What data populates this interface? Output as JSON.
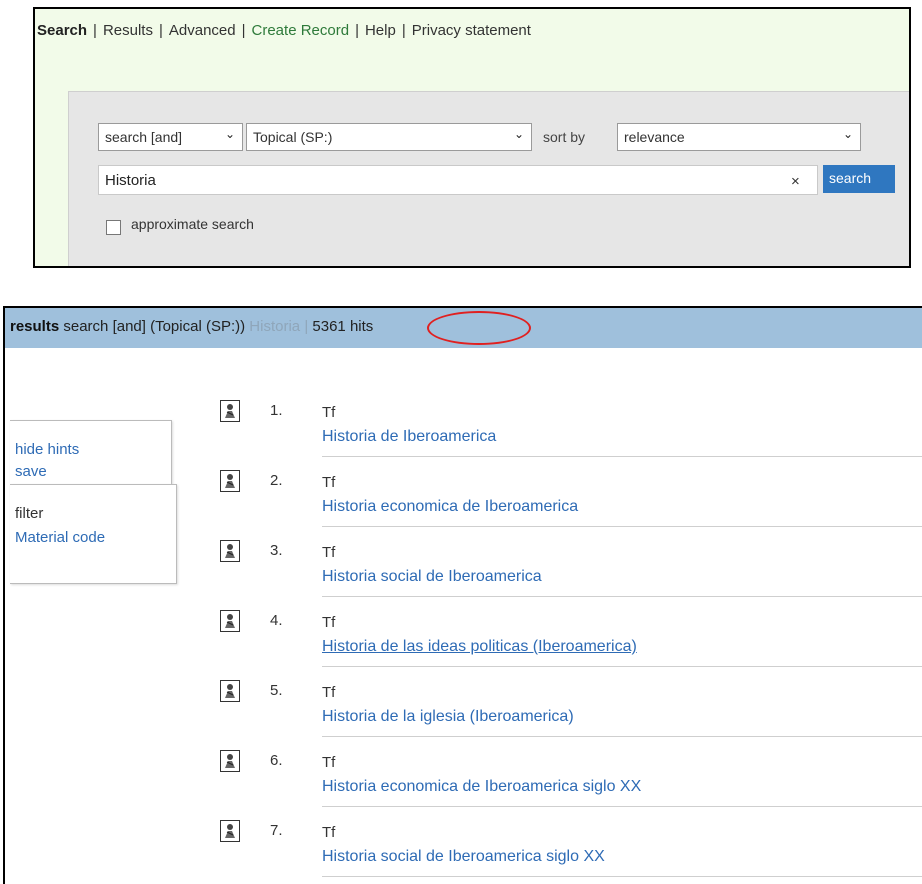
{
  "top_nav": {
    "items": [
      {
        "label": "Search",
        "current": true
      },
      {
        "label": "Results"
      },
      {
        "label": "Advanced"
      },
      {
        "label": "Create Record"
      },
      {
        "label": "Help"
      },
      {
        "label": "Privacy statement"
      }
    ],
    "separator": "|"
  },
  "search_form": {
    "operator_select": "search [and]",
    "field_select": "Topical (SP:)",
    "sort_label": "sort by",
    "sort_select": "relevance",
    "query_value": "Historia",
    "clear_symbol": "×",
    "search_button": "search",
    "approx_label": "approximate search",
    "approx_checked": false
  },
  "results_header": {
    "label": "results",
    "query_desc": "search [and]  (Topical (SP:))",
    "term": "Historia",
    "separator": "|",
    "hits": "5361 hits"
  },
  "sidebar": {
    "hide_hints": "hide hints",
    "save": "save",
    "filter_label": "filter",
    "material_code": "Material code"
  },
  "results": [
    {
      "num": "1.",
      "type": "Tf",
      "title": "Historia de Iberoamerica",
      "icon": "record-icon"
    },
    {
      "num": "2.",
      "type": "Tf",
      "title": "Historia economica de Iberoamerica",
      "icon": "record-icon"
    },
    {
      "num": "3.",
      "type": "Tf",
      "title": "Historia social de Iberoamerica",
      "icon": "record-icon"
    },
    {
      "num": "4.",
      "type": "Tf",
      "title": "Historia de las ideas politicas (Iberoamerica)",
      "icon": "record-icon",
      "hovered": true
    },
    {
      "num": "5.",
      "type": "Tf",
      "title": "Historia de la iglesia (Iberoamerica)",
      "icon": "record-icon"
    },
    {
      "num": "6.",
      "type": "Tf",
      "title": "Historia economica de Iberoamerica siglo XX",
      "icon": "record-icon"
    },
    {
      "num": "7.",
      "type": "Tf",
      "title": "Historia social de Iberoamerica siglo XX",
      "icon": "record-icon"
    }
  ],
  "colors": {
    "link": "#2e6bb5",
    "header_bar": "#9fc0dc",
    "search_button": "#2f77c0",
    "annotation_circle": "#e02020"
  }
}
